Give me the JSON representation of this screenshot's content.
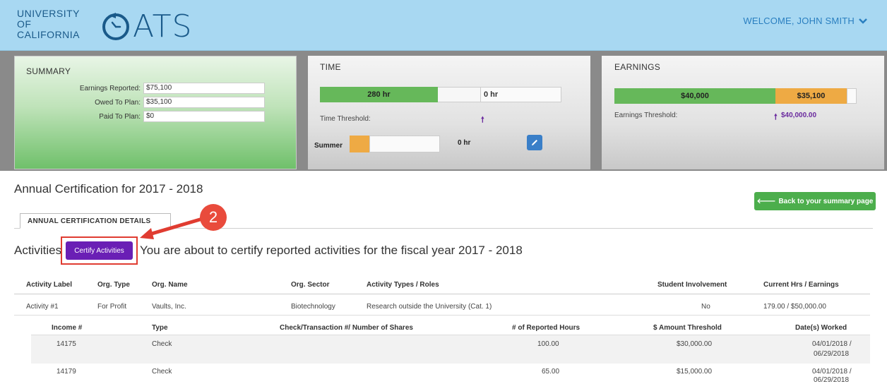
{
  "header": {
    "uc_logo_lines": [
      "UNIVERSITY",
      "OF",
      "CALIFORNIA"
    ],
    "app_name": "ATS",
    "welcome": "WELCOME, JOHN SMITH"
  },
  "summary": {
    "title": "SUMMARY",
    "rows": [
      {
        "label": "Earnings Reported:",
        "value": "$75,100"
      },
      {
        "label": "Owed To Plan:",
        "value": "$35,100"
      },
      {
        "label": "Paid To Plan:",
        "value": "$0"
      }
    ]
  },
  "time": {
    "title": "TIME",
    "green_value": "280 hr",
    "white_value": "0 hr",
    "threshold_label": "Time Threshold:",
    "summer_label": "Summer",
    "summer_value": "0 hr"
  },
  "earnings": {
    "title": "EARNINGS",
    "green_value": "$40,000",
    "orange_value": "$35,100",
    "threshold_label": "Earnings Threshold:",
    "threshold_value": "$40,000.00"
  },
  "page": {
    "heading": "Annual Certification for 2017 - 2018",
    "back_button": "Back to your summary page",
    "tab_label": "ANNUAL CERTIFICATION DETAILS",
    "step_badge": "2",
    "activities_label": "Activities",
    "certify_button": "Certify Activities",
    "certify_message": "You are about to certify reported activities for the fiscal year 2017 - 2018"
  },
  "activities_table": {
    "headers": [
      "Activity Label",
      "Org. Type",
      "Org. Name",
      "Org. Sector",
      "Activity Types / Roles",
      "Student Involvement",
      "Current Hrs / Earnings"
    ],
    "rows": [
      {
        "label": "Activity #1",
        "org_type": "For Profit",
        "org_name": "Vaults, Inc.",
        "sector": "Biotechnology",
        "types": "Research outside the University (Cat. 1)",
        "student": "No",
        "current": "179.00 / $50,000.00"
      }
    ]
  },
  "income_table": {
    "headers": [
      "Income #",
      "Type",
      "Check/Transaction #/ Number of Shares",
      "# of Reported Hours",
      "$ Amount Threshold",
      "Date(s) Worked"
    ],
    "rows": [
      {
        "income": "14175",
        "type": "Check",
        "check": "",
        "hours": "100.00",
        "amount": "$30,000.00",
        "dates_1": "04/01/2018 /",
        "dates_2": "06/29/2018"
      },
      {
        "income": "14179",
        "type": "Check",
        "check": "",
        "hours": "65.00",
        "amount": "$15,000.00",
        "dates_1": "04/01/2018 /",
        "dates_2": "06/29/2018"
      }
    ]
  },
  "colors": {
    "header_bg": "#a8d8f2",
    "certify_purple": "#6a1fb5",
    "back_green": "#4cae4c",
    "highlight_red": "#e03c31",
    "bar_green": "#66b85a",
    "bar_orange": "#eeaa44"
  }
}
